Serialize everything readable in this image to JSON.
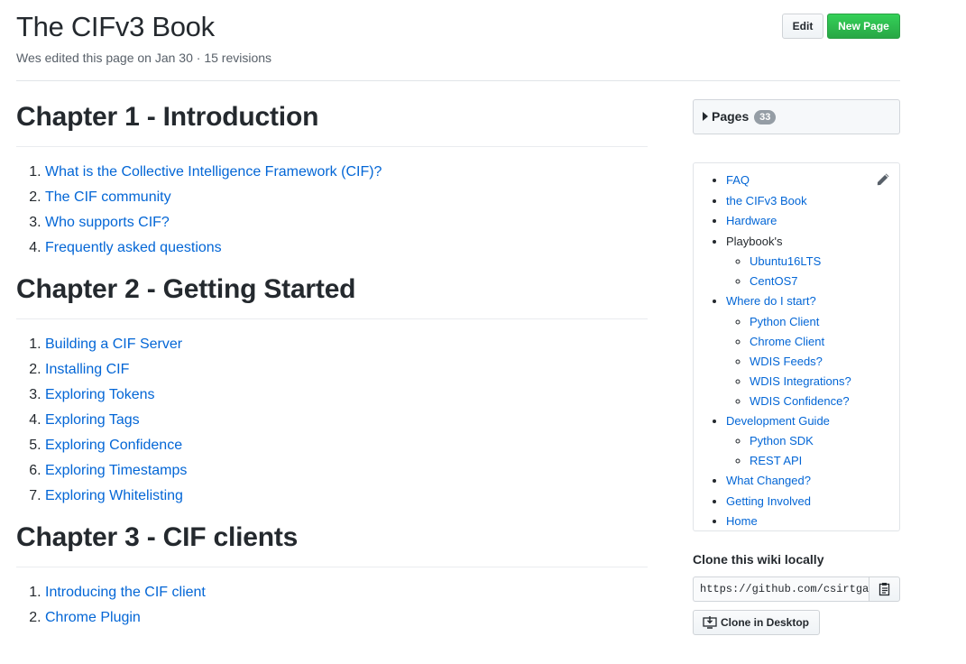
{
  "header": {
    "title": "The CIFv3 Book",
    "meta": "Wes edited this page on Jan 30 · 15 revisions",
    "edit_label": "Edit",
    "new_page_label": "New Page"
  },
  "chapters": [
    {
      "heading": "Chapter 1 - Introduction",
      "items": [
        "What is the Collective Intelligence Framework (CIF)?",
        "The CIF community",
        "Who supports CIF?",
        "Frequently asked questions"
      ]
    },
    {
      "heading": "Chapter 2 - Getting Started",
      "items": [
        "Building a CIF Server",
        "Installing CIF",
        "Exploring Tokens",
        "Exploring Tags",
        "Exploring Confidence",
        "Exploring Timestamps",
        "Exploring Whitelisting"
      ]
    },
    {
      "heading": "Chapter 3 - CIF clients",
      "items": [
        "Introducing the CIF client",
        "Chrome Plugin"
      ]
    }
  ],
  "sidebar": {
    "pages_label": "Pages",
    "pages_count": "33",
    "items": [
      {
        "label": "FAQ",
        "link": true
      },
      {
        "label": "the CIFv3 Book",
        "link": true
      },
      {
        "label": "Hardware",
        "link": true
      },
      {
        "label": "Playbook's",
        "link": false,
        "children": [
          "Ubuntu16LTS",
          "CentOS7"
        ]
      },
      {
        "label": "Where do I start?",
        "link": true,
        "children": [
          "Python Client",
          "Chrome Client",
          "WDIS Feeds?",
          "WDIS Integrations?",
          "WDIS Confidence?"
        ]
      },
      {
        "label": "Development Guide",
        "link": true,
        "children": [
          "Python SDK",
          "REST API"
        ]
      },
      {
        "label": "What Changed?",
        "link": true
      },
      {
        "label": "Getting Involved",
        "link": true
      },
      {
        "label": "Home",
        "link": true
      }
    ]
  },
  "clone": {
    "title": "Clone this wiki locally",
    "url": "https://github.com/csirtgadgets/bearded-avenger.wiki.git",
    "desktop_label": "Clone in Desktop"
  },
  "colors": {
    "link": "#0366d6",
    "primary_button": "#28a745",
    "counter": "#959da5"
  },
  "icons": [
    "pencil-icon",
    "clipboard-icon",
    "desktop-download-icon",
    "caret-right-icon"
  ]
}
